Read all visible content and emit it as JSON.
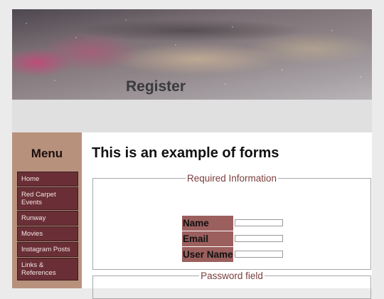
{
  "header": {
    "title": "Register"
  },
  "sidebar": {
    "heading": "Menu",
    "items": [
      {
        "label": "Home"
      },
      {
        "label": "Red Carpet Events"
      },
      {
        "label": "Runway"
      },
      {
        "label": "Movies"
      },
      {
        "label": "Instagram Posts"
      },
      {
        "label": "Links & References"
      }
    ]
  },
  "main": {
    "title": "This is an example of forms",
    "required_legend": "Required Information",
    "fields": [
      {
        "label": "Name",
        "value": ""
      },
      {
        "label": "Email",
        "value": ""
      },
      {
        "label": "User Name",
        "value": ""
      }
    ],
    "password_legend": "Password field"
  },
  "colors": {
    "menu_item_bg": "#6a2f36",
    "sidebar_bg": "#b8917d",
    "legend_text": "#7a3e3c",
    "label_bg": "#9b5f5d"
  }
}
